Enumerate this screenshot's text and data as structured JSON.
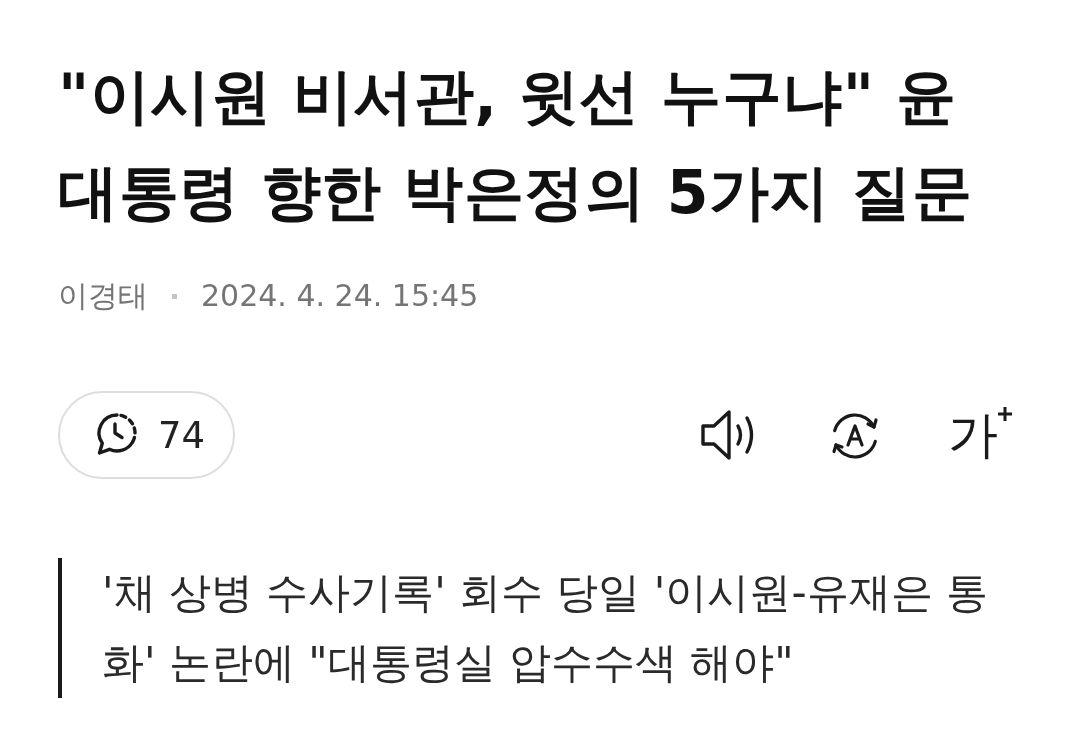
{
  "article": {
    "title": "\"이시원 비서관, 윗선 누구냐\" 윤 대통령 향한 박은정의 5가지 질문",
    "author": "이경태",
    "date": "2024. 4. 24. 15:45",
    "comment_count": "74",
    "tools": [
      {
        "kind": "speaker"
      },
      {
        "kind": "translate"
      },
      {
        "kind": "font_size",
        "label": "가"
      }
    ],
    "summary": "'채 상병 수사기록' 회수 당일 '이시원-유재은 통화' 논란에 \"대통령실 압수수색 해야\""
  }
}
